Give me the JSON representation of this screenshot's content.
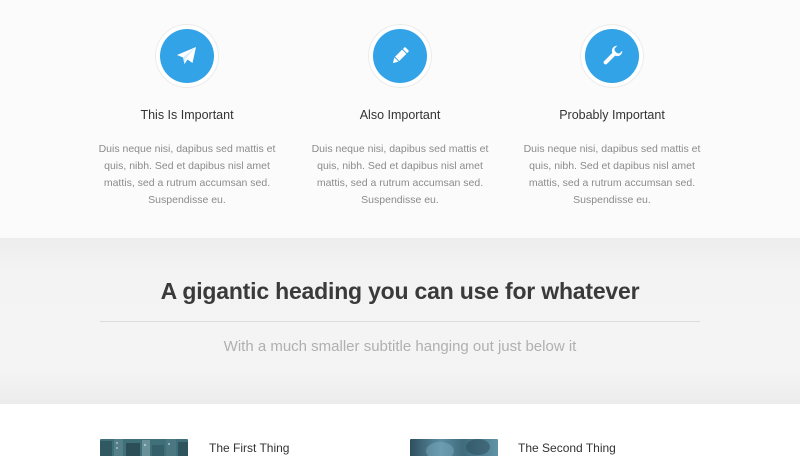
{
  "features": [
    {
      "icon": "paper-plane-icon",
      "title": "This Is Important",
      "body": "Duis neque nisi, dapibus sed mattis et quis, nibh. Sed et dapibus nisl amet mattis, sed a rutrum accumsan sed. Suspendisse eu."
    },
    {
      "icon": "pencil-icon",
      "title": "Also Important",
      "body": "Duis neque nisi, dapibus sed mattis et quis, nibh. Sed et dapibus nisl amet mattis, sed a rutrum accumsan sed. Suspendisse eu."
    },
    {
      "icon": "wrench-icon",
      "title": "Probably Important",
      "body": "Duis neque nisi, dapibus sed mattis et quis, nibh. Sed et dapibus nisl amet mattis, sed a rutrum accumsan sed. Suspendisse eu."
    }
  ],
  "banner": {
    "heading": "A gigantic heading you can use for whatever",
    "subtitle": "With a much smaller subtitle hanging out just below it"
  },
  "things": [
    {
      "title": "The First Thing",
      "image": "city-buildings-image"
    },
    {
      "title": "The Second Thing",
      "image": "blurred-photo-image"
    }
  ],
  "colors": {
    "accent": "#33a3e8",
    "heading": "#3a3a3a",
    "body_text": "#8b8b8b",
    "subtitle": "#b0b0b0"
  }
}
